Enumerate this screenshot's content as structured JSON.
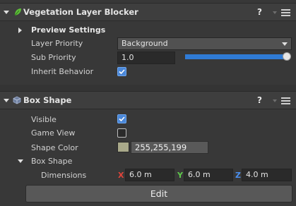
{
  "vegetation": {
    "title": "Vegetation Layer Blocker",
    "help": "?",
    "preview_settings": "Preview Settings",
    "layer_priority_label": "Layer Priority",
    "layer_priority_value": "Background",
    "sub_priority_label": "Sub Priority",
    "sub_priority_value": "1.0",
    "sub_priority_slider_fraction": 1.0,
    "inherit_label": "Inherit Behavior",
    "inherit_checked": true
  },
  "box": {
    "title": "Box Shape",
    "help": "?",
    "visible_label": "Visible",
    "visible_checked": true,
    "game_view_label": "Game View",
    "game_view_checked": false,
    "shape_color_label": "Shape Color",
    "shape_color_value": "255,255,199",
    "shape_color_hex": "#a9a98a",
    "box_shape_label": "Box Shape",
    "dimensions_label": "Dimensions",
    "x_label": "X",
    "x_value": "6.0 m",
    "y_label": "Y",
    "y_value": "6.0 m",
    "z_label": "Z",
    "z_value": "4.0 m",
    "edit_label": "Edit"
  },
  "colors": {
    "accent": "#4a87d8",
    "x_axis": "#e0443a",
    "y_axis": "#5ec94a",
    "z_axis": "#4a8ff0"
  }
}
